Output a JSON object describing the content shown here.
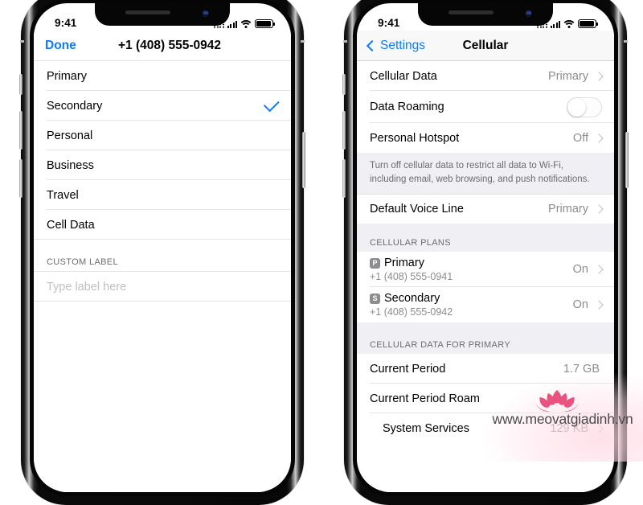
{
  "left_phone": {
    "status_bar": {
      "time": "9:41",
      "signal_icon": "dual-signal-icon",
      "wifi_icon": "wifi-icon",
      "battery_icon": "battery-icon"
    },
    "nav": {
      "done_label": "Done",
      "title": "+1 (408) 555-0942"
    },
    "label_options": [
      {
        "label": "Primary",
        "selected": false
      },
      {
        "label": "Secondary",
        "selected": true
      },
      {
        "label": "Personal",
        "selected": false
      },
      {
        "label": "Business",
        "selected": false
      },
      {
        "label": "Travel",
        "selected": false
      },
      {
        "label": "Cell Data",
        "selected": false
      }
    ],
    "custom_label": {
      "section_header": "CUSTOM LABEL",
      "value": "",
      "placeholder": "Type label here"
    }
  },
  "right_phone": {
    "status_bar": {
      "time": "9:41",
      "signal_icon": "dual-signal-icon",
      "wifi_icon": "wifi-icon",
      "battery_icon": "battery-icon"
    },
    "nav": {
      "back_label": "Settings",
      "title": "Cellular"
    },
    "top_group": [
      {
        "label": "Cellular Data",
        "value": "Primary",
        "type": "disclosure"
      },
      {
        "label": "Data Roaming",
        "value": "off",
        "type": "toggle"
      },
      {
        "label": "Personal Hotspot",
        "value": "Off",
        "type": "disclosure"
      }
    ],
    "footnote": "Turn off cellular data to restrict all data to Wi-Fi, including email, web browsing, and push notifications.",
    "voice_group": [
      {
        "label": "Default Voice Line",
        "value": "Primary",
        "type": "disclosure"
      }
    ],
    "plans_section": {
      "header": "CELLULAR PLANS",
      "plans": [
        {
          "badge": "P",
          "name": "Primary",
          "number": "+1 (408) 555-0941",
          "state": "On"
        },
        {
          "badge": "S",
          "name": "Secondary",
          "number": "+1 (408) 555-0942",
          "state": "On"
        }
      ]
    },
    "usage_section": {
      "header": "CELLULAR DATA FOR PRIMARY",
      "rows": [
        {
          "label": "Current Period",
          "value": "1.7 GB",
          "disclosure": false,
          "indent": false
        },
        {
          "label": "Current Period Roam",
          "value": "",
          "disclosure": false,
          "indent": false
        },
        {
          "label": "System Services",
          "value": "129 KB",
          "disclosure": true,
          "indent": true
        }
      ]
    }
  },
  "watermark": {
    "text": "www.meovatgiadinh.vn",
    "logo_icon": "lotus-flower-icon",
    "color": "#e8537f"
  },
  "colors": {
    "accent_blue": "#0a7cff",
    "group_background": "#efeff4",
    "separator": "#e4e4e6",
    "secondary_text": "#8c8c91"
  }
}
